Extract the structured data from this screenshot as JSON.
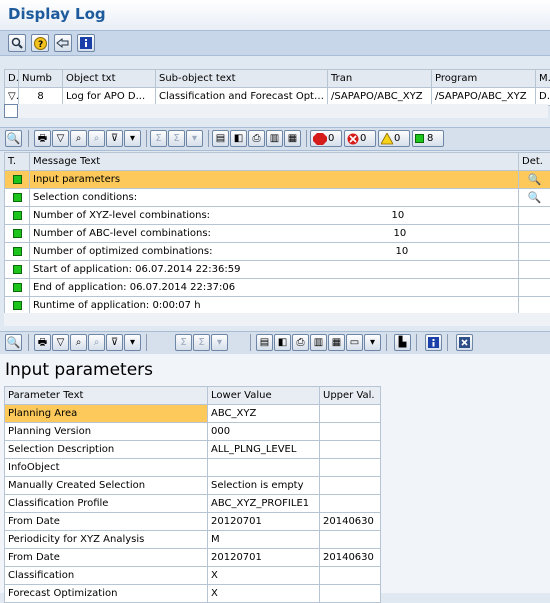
{
  "window": {
    "title": "Display Log"
  },
  "app_toolbar": {
    "icons": [
      "detail-icon",
      "help-icon",
      "technical-info-icon",
      "info-icon"
    ]
  },
  "log_table": {
    "headers": [
      "D",
      "Numb",
      "Object txt",
      "Sub-object text",
      "Tran",
      "Program",
      "Mo"
    ],
    "row": {
      "number": "8",
      "object_text": "Log for APO D...",
      "subobject_text": "Classification and Forecast Opti...",
      "transaction": "/SAPAPO/ABC_XYZ",
      "program": "/SAPAPO/ABC_XYZ",
      "mode": "Dial"
    }
  },
  "message_toolbar": {
    "counts": {
      "stop": "0",
      "error": "0",
      "warning": "0",
      "success": "8"
    }
  },
  "messages": {
    "headers": [
      "T.",
      "Message Text",
      "Det."
    ],
    "rows": [
      {
        "text": "Input parameters",
        "value": "",
        "detail": true,
        "selected": true
      },
      {
        "text": "Selection conditions:",
        "value": "",
        "detail": true,
        "selected": false
      },
      {
        "text": "Number of XYZ-level combinations:",
        "value": "10",
        "detail": false,
        "selected": false
      },
      {
        "text": "Number of ABC-level combinations:",
        "value": "10",
        "detail": false,
        "selected": false
      },
      {
        "text": "Number of optimized combinations:",
        "value": "10",
        "detail": false,
        "selected": false
      },
      {
        "text": "Start of application: 06.07.2014 22:36:59",
        "value": "",
        "detail": false,
        "selected": false
      },
      {
        "text": "End of application: 06.07.2014 22:37:06",
        "value": "",
        "detail": false,
        "selected": false
      },
      {
        "text": "Runtime of application: 0:00:07 h",
        "value": "",
        "detail": false,
        "selected": false
      }
    ]
  },
  "params": {
    "heading": "Input parameters",
    "headers": [
      "Parameter Text",
      "Lower Value",
      "Upper Val."
    ],
    "rows": [
      {
        "param": "Planning Area",
        "lower": "ABC_XYZ",
        "upper": "",
        "selected": true
      },
      {
        "param": "Planning Version",
        "lower": "000",
        "upper": ""
      },
      {
        "param": "Selection Description",
        "lower": "ALL_PLNG_LEVEL",
        "upper": ""
      },
      {
        "param": "InfoObject",
        "lower": "",
        "upper": ""
      },
      {
        "param": "Manually Created Selection",
        "lower": "Selection is empty",
        "upper": ""
      },
      {
        "param": "Classification Profile",
        "lower": "ABC_XYZ_PROFILE1",
        "upper": ""
      },
      {
        "param": "From Date",
        "lower": "20120701",
        "upper": "20140630"
      },
      {
        "param": "Periodicity for XYZ Analysis",
        "lower": "M",
        "upper": ""
      },
      {
        "param": "From Date",
        "lower": "20120701",
        "upper": "20140630"
      },
      {
        "param": "Classification",
        "lower": "X",
        "upper": ""
      },
      {
        "param": "Forecast Optimization",
        "lower": "X",
        "upper": ""
      }
    ]
  },
  "colors": {
    "selection": "#fcc95a",
    "title": "#1d5b9c",
    "success": "#1cc41c"
  }
}
